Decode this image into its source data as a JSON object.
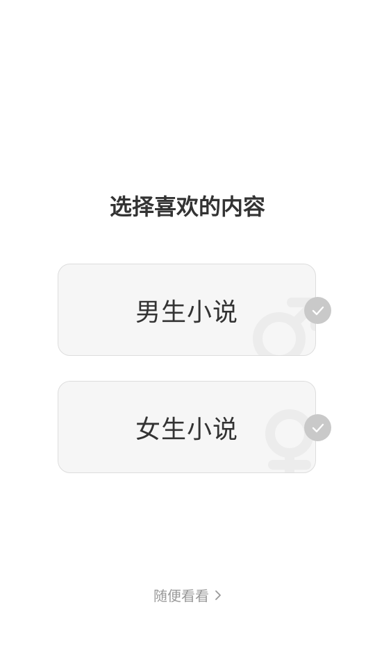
{
  "header": {
    "title": "选择喜欢的内容"
  },
  "options": [
    {
      "label": "男生小说",
      "icon": "male-symbol-icon",
      "selected_indicator": "check-icon"
    },
    {
      "label": "女生小说",
      "icon": "female-symbol-icon",
      "selected_indicator": "check-icon"
    }
  ],
  "footer": {
    "browse_label": "随便看看",
    "browse_icon": "chevron-right-icon"
  },
  "colors": {
    "background": "#ffffff",
    "card_background": "#f6f6f6",
    "card_border": "#dddddd",
    "title_text": "#333333",
    "check_badge": "#c9c9c9",
    "footer_text": "#999999"
  }
}
